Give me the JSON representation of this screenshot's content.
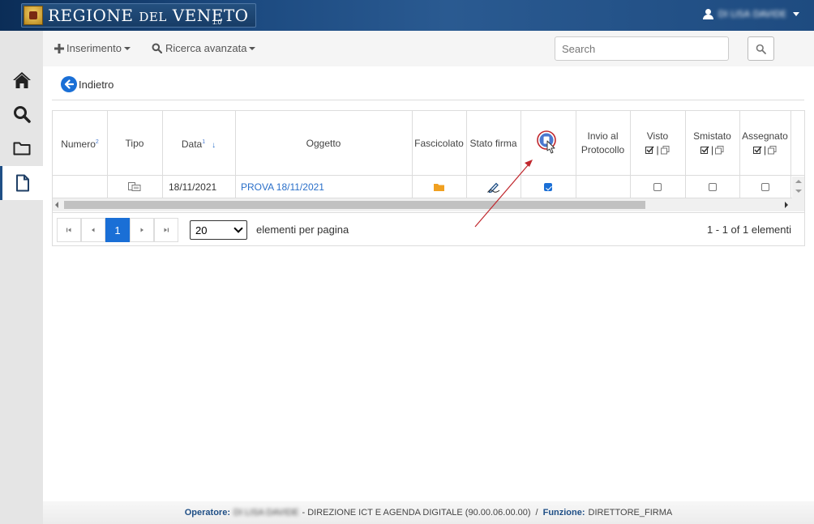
{
  "header": {
    "brand_main": "REGIONE",
    "brand_small": "DEL",
    "brand_end": "VENETO",
    "version": "1.0",
    "user_name": "DI LISA DAVIDE"
  },
  "sidebar": {
    "items": [
      {
        "icon": "home-icon"
      },
      {
        "icon": "search-icon"
      },
      {
        "icon": "folder-icon"
      },
      {
        "icon": "document-icon",
        "active": true
      }
    ]
  },
  "toolbar": {
    "insert_label": "Inserimento",
    "advanced_search_label": "Ricerca avanzata",
    "search_placeholder": "Search"
  },
  "back_label": "Indietro",
  "grid": {
    "columns": {
      "numero": "Numero",
      "numero_sort": "2",
      "tipo": "Tipo",
      "data": "Data",
      "data_sort": "1",
      "oggetto": "Oggetto",
      "fascicolato": "Fascicolato",
      "stato_firma": "Stato firma",
      "invio_line1": "Invio al",
      "invio_line2": "Protocollo",
      "visto": "Visto",
      "smistato": "Smistato",
      "assegnato": "Assegnato",
      "sep": "|"
    },
    "row": {
      "numero": "",
      "data": "18/11/2021",
      "oggetto": "PROVA 18/11/2021",
      "selected": true,
      "visto": false,
      "smistato": false,
      "assegnato": false
    },
    "pager": {
      "current_page": "1",
      "page_size": "20",
      "page_size_label": "elementi per pagina",
      "info": "1 - 1 of 1 elementi"
    }
  },
  "footer": {
    "operator_label": "Operatore:",
    "operator_name": "DI LISA DAVIDE",
    "department": "- DIREZIONE ICT E AGENDA DIGITALE (90.00.06.00.00)",
    "separator": "/",
    "function_label": "Funzione:",
    "function_value": "DIRETTORE_FIRMA"
  },
  "colors": {
    "header_bg": "#1c4a80",
    "accent_blue": "#1a6fd6",
    "folder_orange": "#f0a020",
    "annotation_red": "#c0272d"
  }
}
